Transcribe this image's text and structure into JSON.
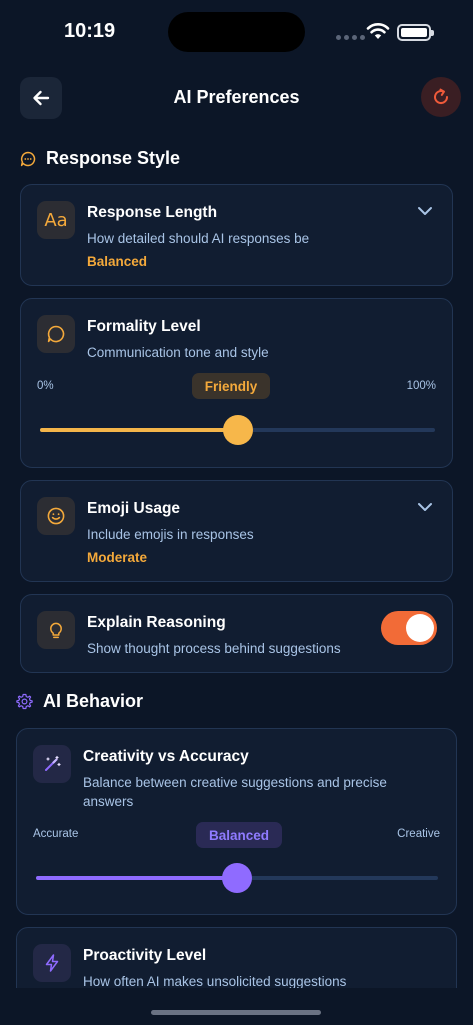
{
  "status_bar": {
    "time": "10:19"
  },
  "header": {
    "title": "AI Preferences"
  },
  "sections": {
    "response_style": "Response Style",
    "ai_behavior": "AI Behavior"
  },
  "response_length": {
    "title": "Response Length",
    "subtitle": "How detailed should AI responses be",
    "value": "Balanced",
    "icon_text": "Aa"
  },
  "formality": {
    "title": "Formality Level",
    "subtitle": "Communication tone and style",
    "min_label": "0%",
    "max_label": "100%",
    "value_label": "Friendly",
    "level": 0.5
  },
  "emoji_usage": {
    "title": "Emoji Usage",
    "subtitle": "Include emojis in responses",
    "value": "Moderate"
  },
  "explain_reasoning": {
    "title": "Explain Reasoning",
    "subtitle": "Show thought process behind suggestions",
    "enabled": true
  },
  "creativity": {
    "title": "Creativity vs Accuracy",
    "subtitle": "Balance between creative suggestions and precise answers",
    "min_label": "Accurate",
    "max_label": "Creative",
    "value_label": "Balanced",
    "level": 0.5
  },
  "proactivity": {
    "title": "Proactivity Level",
    "subtitle": "How often AI makes unsolicited suggestions"
  },
  "colors": {
    "background": "#0c1627",
    "card": "#111d31",
    "accent_orange": "#f4a93b",
    "accent_purple": "#8f6bff",
    "toggle_on": "#f26b37"
  }
}
